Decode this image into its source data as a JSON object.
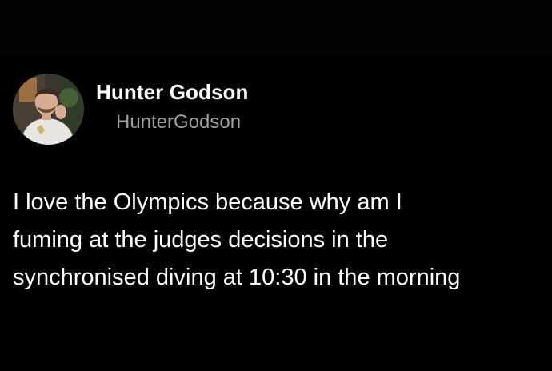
{
  "tweet": {
    "author": {
      "display_name": "Hunter Godson",
      "handle": "HunterGodson",
      "avatar_icon": "profile-photo"
    },
    "text": "I love the Olympics because why am I\nfuming at the judges decisions in the\nsynchronised diving at 10:30 in the morning"
  },
  "colors": {
    "background": "#000000",
    "text_primary": "#ffffff",
    "text_secondary": "#9aa0a6"
  }
}
